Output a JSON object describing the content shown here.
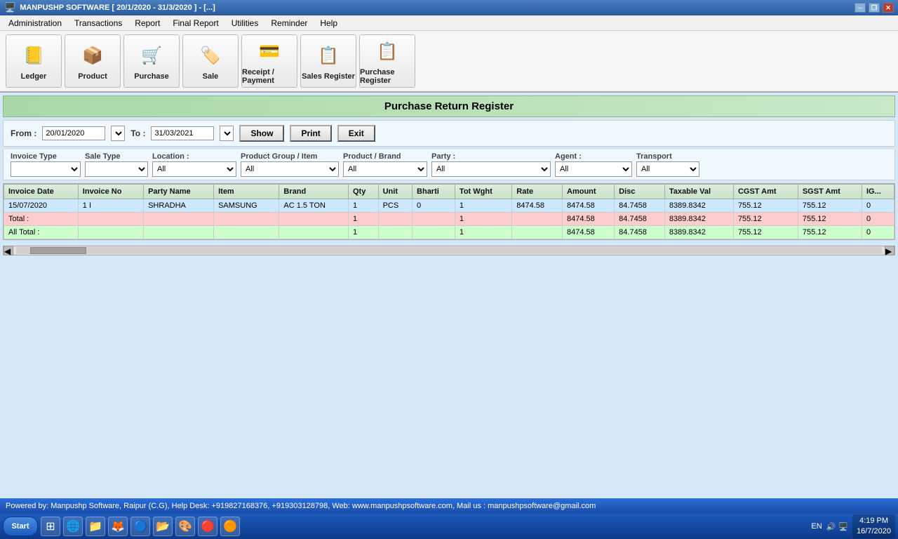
{
  "titleBar": {
    "title": "MANPUSHP SOFTWARE [ 20/1/2020 - 31/3/2020 ]   - [...]",
    "minBtn": "─",
    "restoreBtn": "❐",
    "closeBtn": "✕"
  },
  "menuBar": {
    "items": [
      "Administration",
      "Transactions",
      "Report",
      "Final Report",
      "Utilities",
      "Reminder",
      "Help"
    ]
  },
  "toolbar": {
    "buttons": [
      {
        "label": "Ledger",
        "icon": "📒"
      },
      {
        "label": "Product",
        "icon": "📦"
      },
      {
        "label": "Purchase",
        "icon": "🛒"
      },
      {
        "label": "Sale",
        "icon": "🏷️"
      },
      {
        "label": "Receipt / Payment",
        "icon": "💳"
      },
      {
        "label": "Sales Register",
        "icon": "📋"
      },
      {
        "label": "Purchase Register",
        "icon": "📋"
      }
    ]
  },
  "pageTitle": "Purchase Return Register",
  "filterBar": {
    "fromLabel": "From :",
    "fromValue": "20/01/2020",
    "toLabel": "To :",
    "toValue": "31/03/2021",
    "showBtn": "Show",
    "printBtn": "Print",
    "exitBtn": "Exit"
  },
  "filterRow2": {
    "invoiceTypeLabel": "Invoice Type",
    "saleTypeLabel": "Sale Type",
    "locationLabel": "Location :",
    "locationValue": "All",
    "productGroupLabel": "Product Group / Item",
    "productGroupValue": "All",
    "productBrandLabel": "Product / Brand",
    "productBrandValue": "All",
    "partyLabel": "Party :",
    "partyValue": "All",
    "agentLabel": "Agent :",
    "agentValue": "All",
    "transportLabel": "Transport",
    "transportValue": "All"
  },
  "table": {
    "headers": [
      "Invoice Date",
      "Invoice No",
      "Party Name",
      "Item",
      "Brand",
      "Qty",
      "Unit",
      "Bharti",
      "Tot Wght",
      "Rate",
      "Amount",
      "Disc",
      "Taxable Val",
      "CGST Amt",
      "SGST Amt",
      "IG..."
    ],
    "rows": [
      {
        "type": "data",
        "cells": [
          "15/07/2020",
          "1 I",
          "SHRADHA",
          "SAMSUNG",
          "AC 1.5 TON",
          "1",
          "PCS",
          "0",
          "1",
          "8474.58",
          "8474.58",
          "84.7458",
          "8389.8342",
          "755.12",
          "755.12",
          "0"
        ]
      },
      {
        "type": "total",
        "cells": [
          "Total :",
          "",
          "",
          "",
          "",
          "1",
          "",
          "",
          "1",
          "",
          "8474.58",
          "84.7458",
          "8389.8342",
          "755.12",
          "755.12",
          "0"
        ]
      },
      {
        "type": "alltotal",
        "cells": [
          "All Total :",
          "",
          "",
          "",
          "",
          "1",
          "",
          "",
          "1",
          "",
          "8474.58",
          "84.7458",
          "8389.8342",
          "755.12",
          "755.12",
          "0"
        ]
      }
    ]
  },
  "statusBar": {
    "text": "Powered by: Manpushp Software, Raipur (C.G), Help Desk: +919827168376, +919303128798, Web: www.manpushpsoftware.com,  Mail us :  manpushpsoftware@gmail.com"
  },
  "taskbar": {
    "startLabel": "Start",
    "icons": [
      "🌐",
      "📁",
      "🦊",
      "🔵",
      "📂",
      "🎨",
      "🔴",
      "🟠"
    ],
    "locale": "EN",
    "time": "4:19 PM",
    "date": "16/7/2020"
  }
}
